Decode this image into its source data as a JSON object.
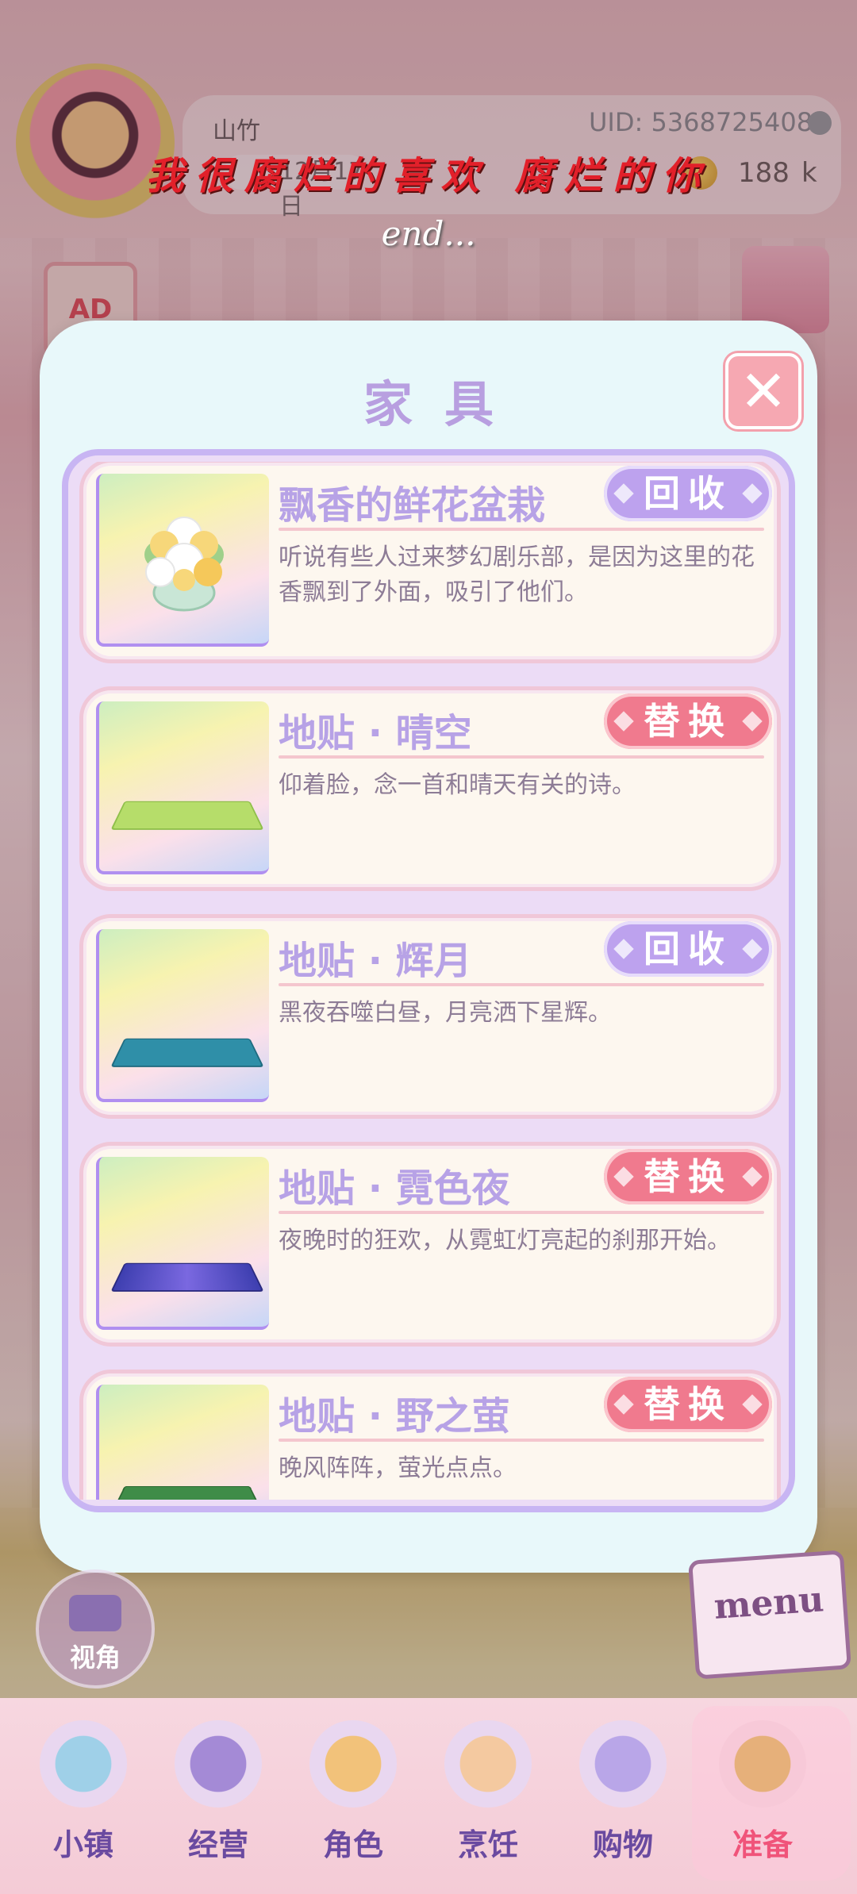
{
  "header": {
    "player_name": "山竹",
    "uid": "UID: 5368725408",
    "date": "12月17日",
    "coins_value": "188",
    "coins_unit": "k"
  },
  "overlay": {
    "subtitle": "我很腐烂的喜欢 腐烂的你",
    "end_text": "end..."
  },
  "ad_badge": "AD",
  "modal": {
    "title": "家具",
    "close_glyph": "✕",
    "items": [
      {
        "name": "飘香的鲜花盆栽",
        "action": "回收",
        "action_style": "purple",
        "description": "听说有些人过来梦幻剧乐部，是因为这里的花香飘到了外面，吸引了他们。",
        "art": "flower-pot"
      },
      {
        "name": "地贴 · 晴空",
        "action": "替换",
        "action_style": "pink",
        "description": "仰着脸，念一首和晴天有关的诗。",
        "art": "tile-green",
        "tile_color": "#b6dd6a"
      },
      {
        "name": "地贴 · 辉月",
        "action": "回收",
        "action_style": "purple",
        "description": "黑夜吞噬白昼，月亮洒下星辉。",
        "art": "tile-teal",
        "tile_color": "#2f8fa8"
      },
      {
        "name": "地贴 · 霓色夜",
        "action": "替换",
        "action_style": "pink",
        "description": "夜晚时的狂欢，从霓虹灯亮起的刹那开始。",
        "art": "tile-purple",
        "tile_color": "#4a4fc0"
      },
      {
        "name": "地贴 · 野之萤",
        "action": "替换",
        "action_style": "pink",
        "description": "晚风阵阵，萤光点点。",
        "art": "tile-forest",
        "tile_color": "#3f8c48"
      }
    ]
  },
  "view_button": {
    "label": "视角"
  },
  "menu_button": {
    "label": "menu"
  },
  "bottom_nav": [
    {
      "label": "小镇",
      "icon": "map-icon",
      "active": false
    },
    {
      "label": "经营",
      "icon": "top-hat-icon",
      "active": false
    },
    {
      "label": "角色",
      "icon": "character-icon",
      "active": false
    },
    {
      "label": "烹饪",
      "icon": "sandwich-icon",
      "active": false
    },
    {
      "label": "购物",
      "icon": "shopping-bag-icon",
      "active": false
    },
    {
      "label": "准备",
      "icon": "basket-icon",
      "active": true
    }
  ],
  "colors": {
    "accent_purple": "#b7a2e6",
    "accent_pink": "#f07a8e",
    "modal_bg": "#e8f8fa",
    "subtitle_red": "#e2202a"
  }
}
